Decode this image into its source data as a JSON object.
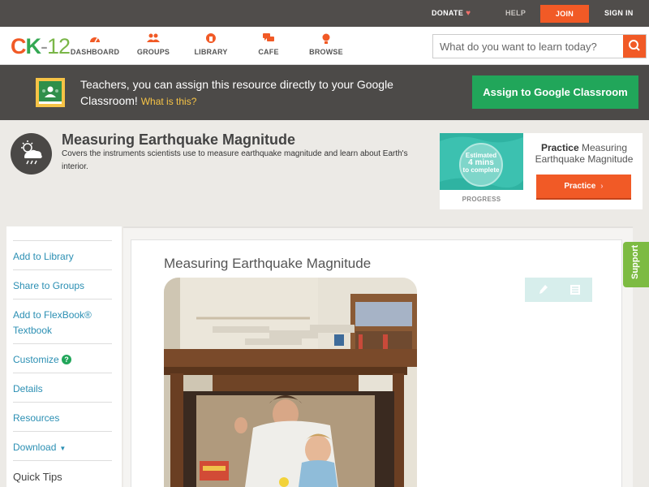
{
  "topbar": {
    "donate": "DONATE",
    "help": "HELP",
    "join": "JOIN",
    "signin": "SIGN IN"
  },
  "logo": {
    "c": "C",
    "k": "K",
    "dash": "-",
    "num": "12"
  },
  "nav": {
    "items": [
      {
        "label": "DASHBOARD",
        "icon": "dashboard-icon"
      },
      {
        "label": "GROUPS",
        "icon": "groups-icon"
      },
      {
        "label": "LIBRARY",
        "icon": "library-icon"
      },
      {
        "label": "CAFE",
        "icon": "cafe-icon"
      },
      {
        "label": "BROWSE",
        "icon": "browse-icon"
      }
    ]
  },
  "search": {
    "placeholder": "What do you want to learn today?"
  },
  "banner": {
    "text": "Teachers, you can assign this resource directly to your Google Classroom!",
    "what": "What is this?",
    "assign_label": "Assign to Google Classroom"
  },
  "header": {
    "title": "Measuring Earthquake Magnitude",
    "description": "Covers the instruments scientists use to measure earthquake magnitude and learn about Earth's interior."
  },
  "practice_card": {
    "estimated": "Estimated",
    "mins": "4 mins",
    "to_complete": "to complete",
    "progress": "PROGRESS",
    "title_bold": "Practice",
    "title_rest": "Measuring Earthquake Magnitude",
    "button": "Practice"
  },
  "sidebar": {
    "items": [
      {
        "label": "Add to Library"
      },
      {
        "label": "Share to Groups"
      },
      {
        "label": "Add to FlexBook® Textbook"
      },
      {
        "label": "Customize",
        "help": "?"
      },
      {
        "label": "Details"
      },
      {
        "label": "Resources"
      },
      {
        "label": "Download",
        "caret": "▼"
      },
      {
        "label": "Quick Tips"
      }
    ]
  },
  "content": {
    "title": "Measuring Earthquake Magnitude"
  },
  "support": {
    "label": "Support"
  },
  "colors": {
    "accent": "#f15a26",
    "green": "#21a65a",
    "link": "#2b8fb3"
  }
}
